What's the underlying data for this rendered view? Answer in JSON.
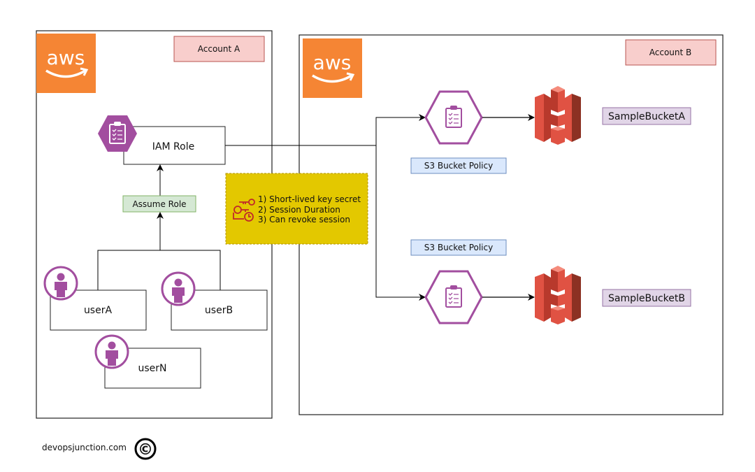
{
  "account_a": {
    "label": "Account A",
    "logo": "aws",
    "iam_role": "IAM Role",
    "assume_role": "Assume Role",
    "users": [
      "userA",
      "userB",
      "userN"
    ]
  },
  "note": {
    "icon": "keys-clock-icon",
    "lines": [
      "1) Short-lived key secret",
      "2) Session Duration",
      "3) Can revoke session"
    ]
  },
  "account_b": {
    "label": "Account B",
    "logo": "aws",
    "policies": [
      "S3 Bucket Policy",
      "S3 Bucket Policy"
    ],
    "buckets": [
      "SampleBucketA",
      "SampleBucketB"
    ]
  },
  "footer": {
    "site": "devopsjunction.com",
    "copyright": "©"
  },
  "colors": {
    "aws_orange": "#f58534",
    "iam_purple": "#a24e9f",
    "s3_red": "#e05243",
    "account_label_fill": "#f8cecc",
    "assume_fill": "#d5e8d4",
    "policy_fill": "#dae8fc",
    "bucket_fill": "#e1d5e7",
    "note_fill": "#e3c800"
  }
}
